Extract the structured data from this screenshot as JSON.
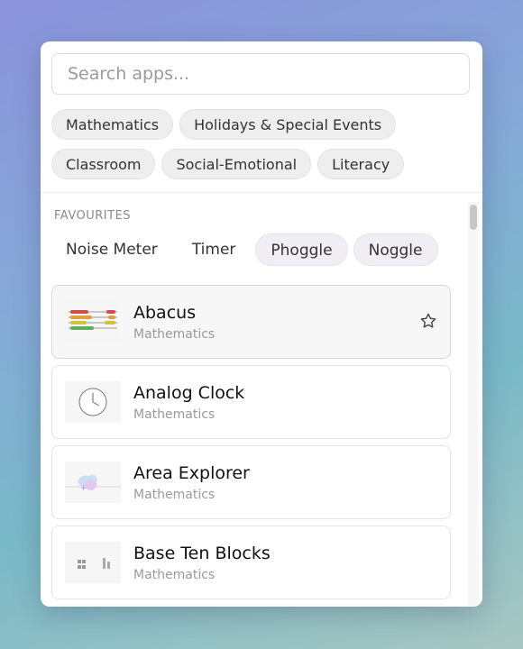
{
  "search": {
    "placeholder": "Search apps...",
    "value": ""
  },
  "categories": [
    [
      "Mathematics",
      "Holidays & Special Events"
    ],
    [
      "Classroom",
      "Social-Emotional",
      "Literacy"
    ]
  ],
  "favourites": {
    "heading": "FAVOURITES",
    "items": [
      "Noise Meter",
      "Timer",
      "Phoggle",
      "Noggle"
    ],
    "highlighted": [
      "Phoggle",
      "Noggle"
    ]
  },
  "apps": [
    {
      "name": "Abacus",
      "category": "Mathematics",
      "icon": "abacus-thumbnail",
      "active": true,
      "star": "star-outline-icon"
    },
    {
      "name": "Analog Clock",
      "category": "Mathematics",
      "icon": "clock-thumbnail"
    },
    {
      "name": "Area Explorer",
      "category": "Mathematics",
      "icon": "area-explorer-thumbnail"
    },
    {
      "name": "Base Ten Blocks",
      "category": "Mathematics",
      "icon": "base-ten-blocks-thumbnail"
    }
  ],
  "colors": {
    "star": "#444444",
    "chip_bg": "#eeeeee",
    "fav_highlight_bg": "#f0eef4"
  }
}
